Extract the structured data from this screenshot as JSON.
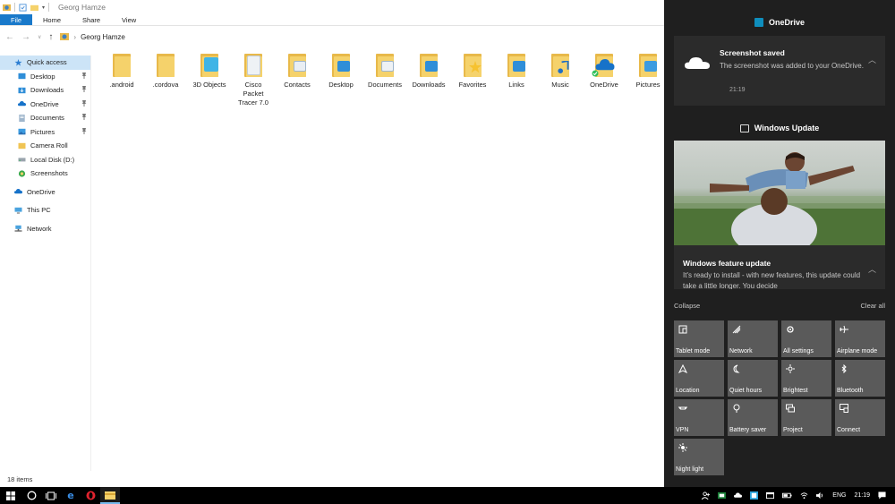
{
  "titlebar": {
    "title": "Georg Hamze"
  },
  "ribbon": {
    "tabs": [
      "File",
      "Home",
      "Share",
      "View"
    ]
  },
  "address": {
    "path": "Georg Hamze"
  },
  "nav": {
    "quick_access": "Quick access",
    "quick_items": [
      {
        "label": "Desktop",
        "pinned": true,
        "icon": "desktop-folder"
      },
      {
        "label": "Downloads",
        "pinned": true,
        "icon": "downloads-folder"
      },
      {
        "label": "OneDrive",
        "pinned": true,
        "icon": "onedrive-cloud"
      },
      {
        "label": "Documents",
        "pinned": true,
        "icon": "documents-folder"
      },
      {
        "label": "Pictures",
        "pinned": true,
        "icon": "pictures-folder"
      },
      {
        "label": "Camera Roll",
        "pinned": false,
        "icon": "folder"
      },
      {
        "label": "Local Disk (D:)",
        "pinned": false,
        "icon": "drive"
      },
      {
        "label": "Screenshots",
        "pinned": false,
        "icon": "screenshots"
      }
    ],
    "onedrive": "OneDrive",
    "this_pc": "This PC",
    "network": "Network",
    "pin_glyph": "📌"
  },
  "files": [
    {
      "label": ".android",
      "badge": "none"
    },
    {
      "label": ".cordova",
      "badge": "none"
    },
    {
      "label": "3D Objects",
      "badge": "3d"
    },
    {
      "label": "Cisco Packet Tracer 7.0",
      "badge": "doc"
    },
    {
      "label": "Contacts",
      "badge": "contacts"
    },
    {
      "label": "Desktop",
      "badge": "desktop"
    },
    {
      "label": "Documents",
      "badge": "documents"
    },
    {
      "label": "Downloads",
      "badge": "downloads"
    },
    {
      "label": "Favorites",
      "badge": "star"
    },
    {
      "label": "Links",
      "badge": "links"
    },
    {
      "label": "Music",
      "badge": "music"
    },
    {
      "label": "OneDrive",
      "badge": "onedrive"
    },
    {
      "label": "Pictures",
      "badge": "pictures"
    }
  ],
  "status": {
    "item_count": "18 items"
  },
  "action_center": {
    "onedrive_header": "OneDrive",
    "toast": {
      "title": "Screenshot saved",
      "body": "The screenshot was added to your OneDrive.",
      "time": "21:19"
    },
    "wu_header": "Windows Update",
    "wu_card": {
      "title": "Windows feature update",
      "body": "It's ready to install - with new features, this update could take a little longer. You decide"
    },
    "collapse": "Collapse",
    "clear_all": "Clear all",
    "tiles": [
      {
        "label": "Tablet mode",
        "icon": "tablet-icon"
      },
      {
        "label": "Network",
        "icon": "network-icon"
      },
      {
        "label": "All settings",
        "icon": "gear-icon"
      },
      {
        "label": "Airplane mode",
        "icon": "airplane-icon"
      },
      {
        "label": "Location",
        "icon": "location-icon"
      },
      {
        "label": "Quiet hours",
        "icon": "moon-icon"
      },
      {
        "label": "Brightest",
        "icon": "sun-icon"
      },
      {
        "label": "Bluetooth",
        "icon": "bluetooth-icon"
      },
      {
        "label": "VPN",
        "icon": "vpn-icon"
      },
      {
        "label": "Battery saver",
        "icon": "battery-saver-icon"
      },
      {
        "label": "Project",
        "icon": "project-icon"
      },
      {
        "label": "Connect",
        "icon": "connect-icon"
      },
      {
        "label": "Night light",
        "icon": "night-light-icon"
      }
    ]
  },
  "taskbar": {
    "language": "ENG",
    "time": "21:19"
  },
  "colors": {
    "accent": "#1979ca",
    "action_center_bg": "#1f1f1f",
    "tile_bg": "#5a5a5a",
    "folder": "#f5d26b",
    "opera_red": "#e0232e",
    "edge_blue": "#3a8ee6"
  }
}
